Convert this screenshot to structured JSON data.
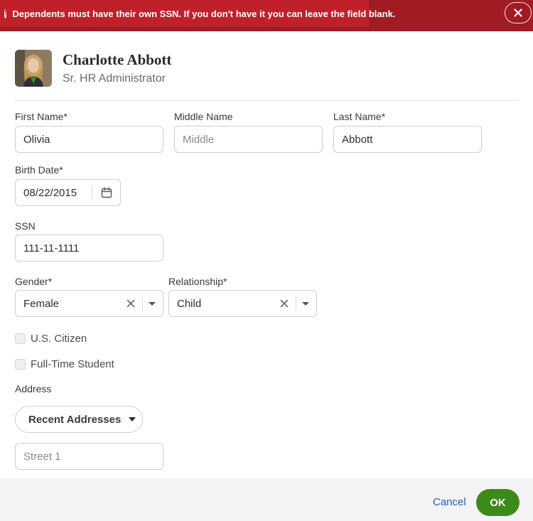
{
  "alert": {
    "message": "Dependents must have their own SSN. If you don't have it you can leave the field blank.",
    "icon": "exclamation-circle-icon",
    "close_icon": "close-icon",
    "bg_color": "#c0202a"
  },
  "profile": {
    "name": "Charlotte Abbott",
    "title": "Sr. HR Administrator"
  },
  "form": {
    "first_name": {
      "label": "First Name*",
      "value": "Olivia"
    },
    "middle_name": {
      "label": "Middle Name",
      "value": "",
      "placeholder": "Middle"
    },
    "last_name": {
      "label": "Last Name*",
      "value": "Abbott"
    },
    "birth_date": {
      "label": "Birth Date*",
      "value": "08/22/2015",
      "icon": "calendar-icon"
    },
    "ssn": {
      "label": "SSN",
      "value": "111-11-1111"
    },
    "gender": {
      "label": "Gender*",
      "value": "Female"
    },
    "relationship": {
      "label": "Relationship*",
      "value": "Child"
    },
    "us_citizen": {
      "label": "U.S. Citizen",
      "checked": false
    },
    "full_time_student": {
      "label": "Full-Time Student",
      "checked": false
    },
    "address": {
      "label": "Address",
      "recent_label": "Recent Addresses",
      "street1_placeholder": "Street 1"
    }
  },
  "footer": {
    "cancel_label": "Cancel",
    "ok_label": "OK",
    "ok_color": "#3d8a1b",
    "cancel_color": "#1f5bc1"
  }
}
